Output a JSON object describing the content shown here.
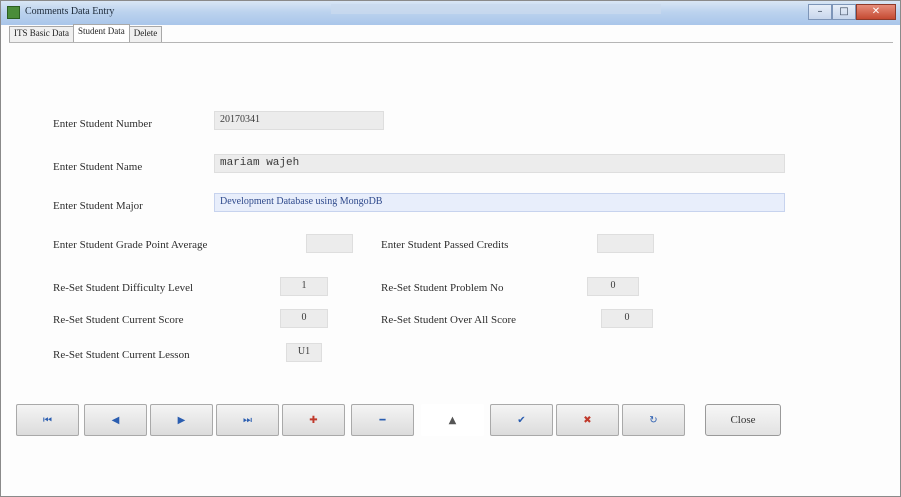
{
  "window": {
    "title": "Comments Data Entry",
    "controls": [
      "–",
      "□",
      "✕"
    ]
  },
  "tabs": [
    "ITS Basic Data",
    "Student Data",
    "Delete"
  ],
  "form": {
    "student_number_label": "Enter Student Number",
    "student_number_value": "20170341",
    "student_name_label": "Enter Student Name",
    "student_name_value": "mariam wajeh",
    "student_major_label": "Enter Student Major",
    "student_major_value": "Development Database using MongoDB",
    "gpa_label": "Enter Student Grade Point Average",
    "gpa_value": "",
    "passed_credits_label": "Enter Student Passed Credits",
    "passed_credits_value": "",
    "difficulty_label": "Re-Set Student Difficulty Level",
    "difficulty_value": "1",
    "problem_no_label": "Re-Set Student Problem No",
    "problem_no_value": "0",
    "current_score_label": "Re-Set Student Current Score",
    "current_score_value": "0",
    "overall_score_label": "Re-Set Student Over All Score",
    "overall_score_value": "0",
    "current_lesson_label": "Re-Set Student Current Lesson",
    "current_lesson_value": "U1"
  },
  "nav_buttons": [
    {
      "name": "first-record-button",
      "glyph": "⏮",
      "color": "#2a5db0"
    },
    {
      "name": "previous-record-button",
      "glyph": "◀",
      "color": "#2a5db0"
    },
    {
      "name": "next-record-button",
      "glyph": "▶",
      "color": "#2a5db0"
    },
    {
      "name": "last-record-button",
      "glyph": "⏭",
      "color": "#2a5db0"
    },
    {
      "name": "add-record-button",
      "glyph": "✚",
      "color": "#c0392b"
    },
    {
      "name": "delete-record-button",
      "glyph": "━",
      "color": "#2a5db0"
    },
    {
      "name": "move-up-button",
      "glyph": "▲",
      "color": "#555555"
    },
    {
      "name": "save-record-button",
      "glyph": "✔",
      "color": "#2a5db0"
    },
    {
      "name": "cancel-edit-button",
      "glyph": "✖",
      "color": "#c0392b"
    },
    {
      "name": "refresh-button",
      "glyph": "↻",
      "color": "#2a5db0"
    }
  ],
  "close_label": "Close"
}
